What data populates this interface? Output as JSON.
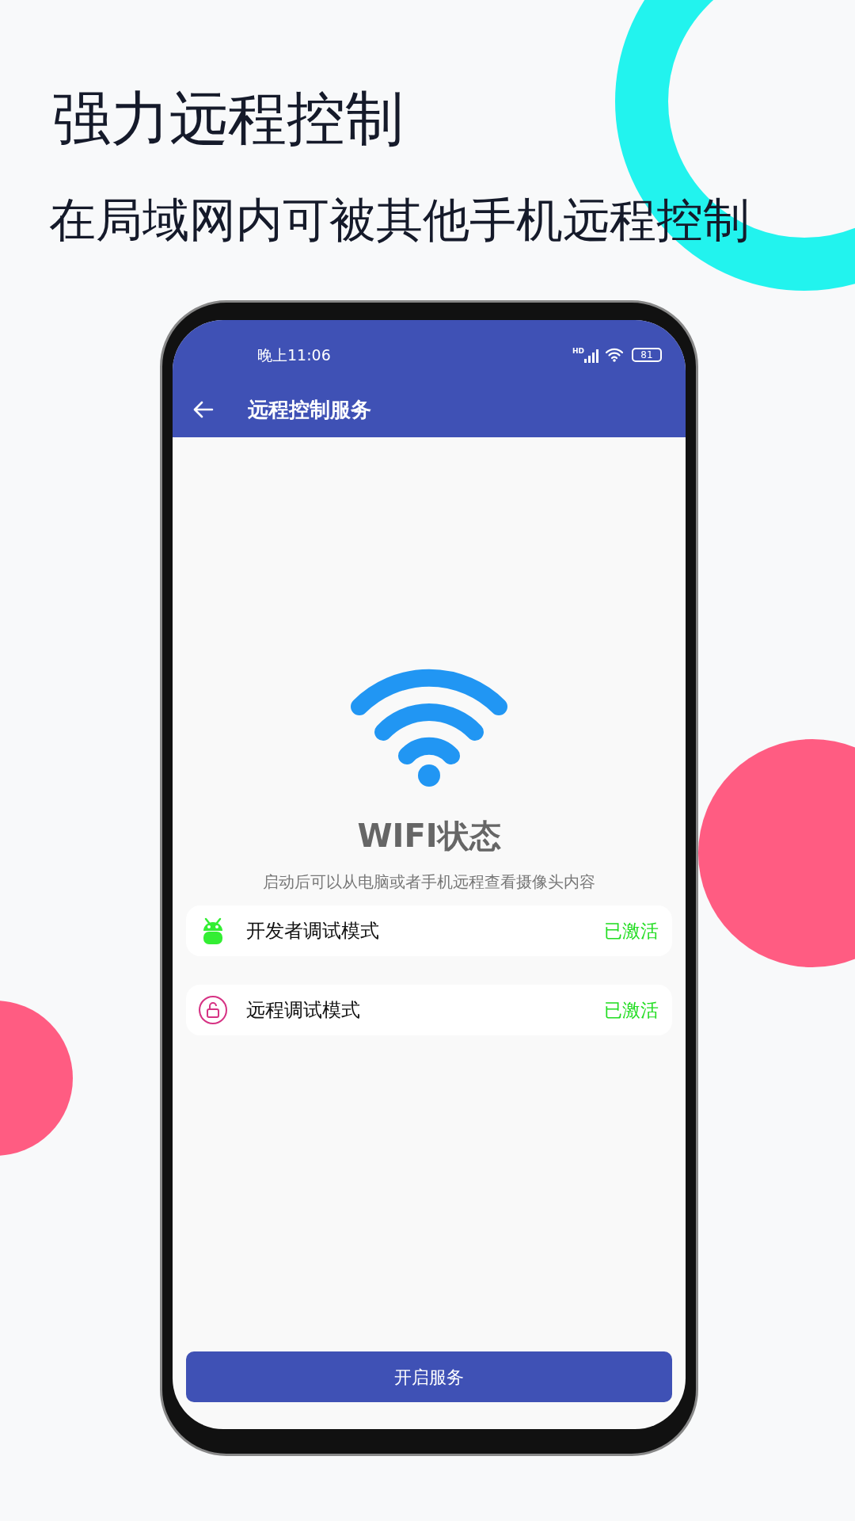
{
  "headline": "强力远程控制",
  "subheadline": "在局域网内可被其他手机远程控制",
  "status_bar": {
    "time": "晚上11:06",
    "signal_label": "HD",
    "battery": "81"
  },
  "app_bar": {
    "title": "远程控制服务"
  },
  "status_title": "WIFI状态",
  "description": "启动后可以从电脑或者手机远程查看摄像头内容",
  "modes": [
    {
      "kind": "android",
      "label": "开发者调试模式",
      "status": "已激活"
    },
    {
      "kind": "lock",
      "label": "远程调试模式",
      "status": "已激活"
    }
  ],
  "primary_button": "开启服务"
}
